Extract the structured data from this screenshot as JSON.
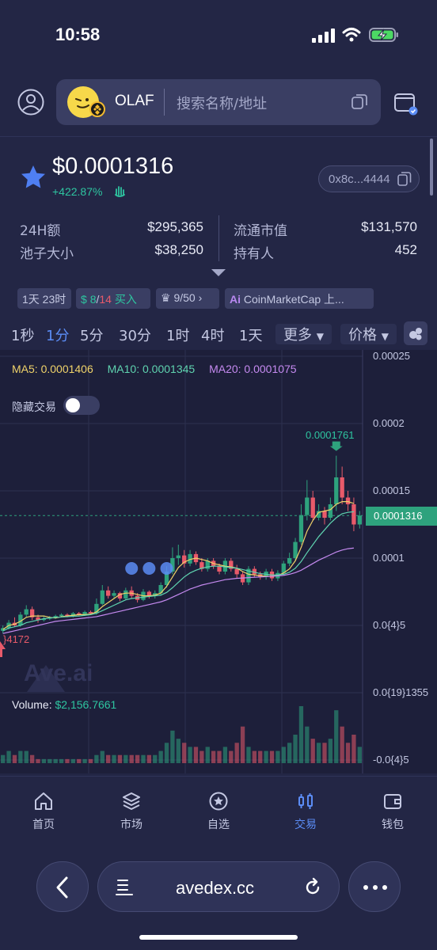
{
  "status_bar": {
    "time": "10:58"
  },
  "search": {
    "token_name": "OLAF",
    "placeholder": "搜索名称/地址"
  },
  "token": {
    "price": "$0.0001316",
    "change": "+422.87%",
    "address": "0x8c...4444"
  },
  "stats": {
    "volume_24h_label": "24H额",
    "volume_24h": "$295,365",
    "pool_label": "池子大小",
    "pool": "$38,250",
    "mcap_label": "流通市值",
    "mcap": "$131,570",
    "holders_label": "持有人",
    "holders": "452"
  },
  "pills": {
    "age": "1天 23时",
    "buy_a": "8",
    "buy_sep": "/",
    "buy_b": "14",
    "buy_label": " 买入",
    "rank": "9/50",
    "listing": "CoinMarketCap 上..."
  },
  "timeframes": [
    "1秒",
    "1分",
    "5分",
    "30分",
    "1时",
    "4时",
    "1天"
  ],
  "active_timeframe": "1分",
  "tf_more": "更多",
  "tf_price": "价格",
  "chart": {
    "ma5": "MA5: 0.0001406",
    "ma10": "MA10: 0.0001345",
    "ma20": "MA20: 0.0001075",
    "hide_trades": "隐藏交易",
    "y_labels": [
      "0.00025",
      "0.0002",
      "0.00015",
      "0.0001",
      "0.0{4}5",
      "0.0{19}1355",
      "-0.0{4}5"
    ],
    "current_price_tag": "0.0001316",
    "high_label": "0.0001761",
    "low_label": "}4172",
    "watermark": "Ave.ai",
    "volume_label": "Volume: ",
    "volume_value": "$2,156.7661",
    "colors": {
      "up": "#2ea27d",
      "down": "#e85a6a",
      "ma5": "#f0d36a",
      "ma10": "#5fd4b0",
      "ma20": "#c58af0"
    }
  },
  "chart_data": {
    "type": "candlestick",
    "title": "",
    "ylim": [
      -5e-05,
      0.00025
    ],
    "candles": [
      [
        4.6e-05,
        4.8e-05,
        4.4e-05,
        5e-05
      ],
      [
        4.8e-05,
        5.2e-05,
        4.7e-05,
        5.4e-05
      ],
      [
        5.2e-05,
        5e-05,
        4.9e-05,
        5.6e-05
      ],
      [
        5e-05,
        5.8e-05,
        4.9e-05,
        6e-05
      ],
      [
        5.8e-05,
        6.2e-05,
        5.6e-05,
        6.5e-05
      ],
      [
        6.2e-05,
        5.6e-05,
        5.4e-05,
        6.4e-05
      ],
      [
        5.6e-05,
        5.4e-05,
        5.2e-05,
        5.8e-05
      ],
      [
        5.4e-05,
        5.5e-05,
        5.3e-05,
        5.7e-05
      ],
      [
        5.5e-05,
        5.6e-05,
        5.4e-05,
        5.7e-05
      ],
      [
        5.6e-05,
        5.7e-05,
        5.5e-05,
        5.8e-05
      ],
      [
        5.7e-05,
        5.8e-05,
        5.6e-05,
        5.9e-05
      ],
      [
        5.8e-05,
        5.7e-05,
        5.6e-05,
        5.9e-05
      ],
      [
        5.7e-05,
        5.9e-05,
        5.6e-05,
        6e-05
      ],
      [
        5.9e-05,
        5.8e-05,
        5.7e-05,
        6e-05
      ],
      [
        5.8e-05,
        6e-05,
        5.7e-05,
        6.1e-05
      ],
      [
        6e-05,
        5.9e-05,
        5.8e-05,
        6.1e-05
      ],
      [
        5.9e-05,
        6.6e-05,
        5.8e-05,
        7e-05
      ],
      [
        6.6e-05,
        7.6e-05,
        6.5e-05,
        8e-05
      ],
      [
        7.6e-05,
        7.2e-05,
        7e-05,
        7.9e-05
      ],
      [
        7.2e-05,
        7.4e-05,
        7e-05,
        7.6e-05
      ],
      [
        7.4e-05,
        7e-05,
        6.8e-05,
        7.5e-05
      ],
      [
        7e-05,
        7.6e-05,
        6.9e-05,
        7.8e-05
      ],
      [
        7.6e-05,
        7.2e-05,
        7e-05,
        7.9e-05
      ],
      [
        7.2e-05,
        6.9e-05,
        6.7e-05,
        7.4e-05
      ],
      [
        6.9e-05,
        7.5e-05,
        6.8e-05,
        7.7e-05
      ],
      [
        7.5e-05,
        7.2e-05,
        7e-05,
        7.6e-05
      ],
      [
        7.2e-05,
        7.4e-05,
        7e-05,
        7.6e-05
      ],
      [
        7.4e-05,
        8e-05,
        7.2e-05,
        8.2e-05
      ],
      [
        8e-05,
        9e-05,
        7.8e-05,
        9.4e-05
      ],
      [
        9e-05,
        0.0001,
        8.8e-05,
        0.000108
      ],
      [
        0.0001,
        0.000102,
        9.5e-05,
        0.00011
      ],
      [
        0.000102,
        9.6e-05,
        9.3e-05,
        0.000106
      ],
      [
        9.6e-05,
        0.000103,
        9.4e-05,
        0.000106
      ],
      [
        0.000103,
        9.7e-05,
        9.5e-05,
        0.000105
      ],
      [
        9.7e-05,
        9.2e-05,
        9e-05,
        0.0001
      ],
      [
        9.2e-05,
        9.8e-05,
        9e-05,
        0.0001
      ],
      [
        9.8e-05,
        9.4e-05,
        9.2e-05,
        0.0001
      ],
      [
        9.4e-05,
        9e-05,
        8.8e-05,
        9.6e-05
      ],
      [
        9e-05,
        9.8e-05,
        8.8e-05,
        0.0001
      ],
      [
        9.8e-05,
        9.2e-05,
        9e-05,
        0.0001
      ],
      [
        9.2e-05,
        8.8e-05,
        8.5e-05,
        9.5e-05
      ],
      [
        8.8e-05,
        8.2e-05,
        8e-05,
        9e-05
      ],
      [
        8.2e-05,
        9.2e-05,
        8e-05,
        9.4e-05
      ],
      [
        9.2e-05,
        8.8e-05,
        8.6e-05,
        9.4e-05
      ],
      [
        8.8e-05,
        8.6e-05,
        8.4e-05,
        9e-05
      ],
      [
        8.6e-05,
        9e-05,
        8.4e-05,
        9.2e-05
      ],
      [
        9e-05,
        8.5e-05,
        8.3e-05,
        9.2e-05
      ],
      [
        8.5e-05,
        8.9e-05,
        8.3e-05,
        9.1e-05
      ],
      [
        8.9e-05,
        9.6e-05,
        8.8e-05,
        9.8e-05
      ],
      [
        9.6e-05,
        0.0001,
        9.4e-05,
        0.000104
      ],
      [
        0.0001,
        0.000112,
        9.8e-05,
        0.000115
      ],
      [
        0.000112,
        0.000132,
        0.00011,
        0.00014
      ],
      [
        0.000132,
        0.000145,
        0.000128,
        0.000158
      ],
      [
        0.000145,
        0.00013,
        0.000128,
        0.00015
      ],
      [
        0.00013,
        0.000135,
        0.000128,
        0.00014
      ],
      [
        0.000135,
        0.00013,
        0.000125,
        0.000138
      ],
      [
        0.00013,
        0.00014,
        0.000128,
        0.000145
      ],
      [
        0.00014,
        0.00016,
        0.000135,
        0.0001761
      ],
      [
        0.00016,
        0.000145,
        0.00014,
        0.000168
      ],
      [
        0.000145,
        0.00014,
        0.000135,
        0.00015
      ],
      [
        0.00014,
        0.000125,
        0.00012,
        0.000145
      ],
      [
        0.000125,
        0.0001316,
        0.000122,
        0.000135
      ]
    ],
    "volumes": [
      2,
      3,
      2,
      3,
      3,
      2,
      1,
      1,
      1,
      1,
      1,
      1,
      1,
      1,
      1,
      1,
      2,
      3,
      2,
      2,
      2,
      2,
      2,
      2,
      2,
      2,
      2,
      3,
      5,
      8,
      6,
      5,
      4,
      4,
      3,
      4,
      3,
      3,
      4,
      3,
      5,
      9,
      4,
      3,
      3,
      3,
      3,
      3,
      4,
      5,
      7,
      14,
      9,
      6,
      5,
      5,
      6,
      13,
      9,
      5,
      7,
      4
    ],
    "series": [
      {
        "name": "MA5",
        "values": [
          4.7e-05,
          5e-05,
          5.1e-05,
          5.3e-05,
          5.6e-05,
          5.7e-05,
          5.7e-05,
          5.7e-05,
          5.6e-05,
          5.55e-05,
          5.65e-05,
          5.7e-05,
          5.75e-05,
          5.8e-05,
          5.8e-05,
          5.85e-05,
          6e-05,
          6.4e-05,
          6.7e-05,
          7e-05,
          7.3e-05,
          7.4e-05,
          7.4e-05,
          7.3e-05,
          7.2e-05,
          7.2e-05,
          7.25e-05,
          7.4e-05,
          7.9e-05,
          8.6e-05,
          9.3e-05,
          9.7e-05,
          9.9e-05,
          0.0001,
          9.9e-05,
          9.8e-05,
          9.6e-05,
          9.5e-05,
          9.4e-05,
          9.35e-05,
          9.25e-05,
          9e-05,
          8.8e-05,
          8.75e-05,
          8.7e-05,
          8.65e-05,
          8.65e-05,
          8.7e-05,
          8.9e-05,
          9.2e-05,
          9.8e-05,
          0.000108,
          0.00012,
          0.000128,
          0.000134,
          0.000135,
          0.000136,
          0.00014,
          0.000142,
          0.000142,
          0.0001406
        ]
      },
      {
        "name": "MA10",
        "values": [
          4.6e-05,
          4.8e-05,
          4.9e-05,
          5e-05,
          5.2e-05,
          5.3e-05,
          5.4e-05,
          5.5e-05,
          5.55e-05,
          5.6e-05,
          5.62e-05,
          5.65e-05,
          5.68e-05,
          5.7e-05,
          5.75e-05,
          5.8e-05,
          5.9e-05,
          6.1e-05,
          6.3e-05,
          6.5e-05,
          6.7e-05,
          6.9e-05,
          7e-05,
          7.05e-05,
          7.1e-05,
          7.15e-05,
          7.2e-05,
          7.25e-05,
          7.45e-05,
          7.8e-05,
          8.2e-05,
          8.6e-05,
          8.9e-05,
          9.1e-05,
          9.25e-05,
          9.35e-05,
          9.4e-05,
          9.4e-05,
          9.35e-05,
          9.3e-05,
          9.25e-05,
          9.15e-05,
          9.05e-05,
          8.95e-05,
          8.85e-05,
          8.8e-05,
          8.75e-05,
          8.75e-05,
          8.8e-05,
          8.95e-05,
          9.25e-05,
          9.75e-05,
          0.000104,
          0.00011,
          0.000116,
          0.000121,
          0.000126,
          0.00013,
          0.000133,
          0.000134,
          0.0001345
        ]
      },
      {
        "name": "MA20",
        "values": [
          4.4e-05,
          4.5e-05,
          4.6e-05,
          4.7e-05,
          4.8e-05,
          4.9e-05,
          5e-05,
          5.1e-05,
          5.2e-05,
          5.3e-05,
          5.35e-05,
          5.4e-05,
          5.45e-05,
          5.5e-05,
          5.55e-05,
          5.6e-05,
          5.65e-05,
          5.75e-05,
          5.85e-05,
          5.95e-05,
          6.05e-05,
          6.15e-05,
          6.25e-05,
          6.35e-05,
          6.45e-05,
          6.55e-05,
          6.65e-05,
          6.75e-05,
          6.9e-05,
          7.1e-05,
          7.3e-05,
          7.5e-05,
          7.7e-05,
          7.85e-05,
          8e-05,
          8.1e-05,
          8.2e-05,
          8.3e-05,
          8.4e-05,
          8.45e-05,
          8.5e-05,
          8.52e-05,
          8.55e-05,
          8.58e-05,
          8.6e-05,
          8.62e-05,
          8.65e-05,
          8.68e-05,
          8.72e-05,
          8.8e-05,
          8.92e-05,
          9.1e-05,
          9.35e-05,
          9.6e-05,
          9.85e-05,
          0.0001005,
          0.0001025,
          0.0001045,
          0.000106,
          0.000107,
          0.0001075
        ]
      }
    ]
  },
  "bottom_nav": [
    {
      "label": "首页",
      "icon": "home-icon"
    },
    {
      "label": "市场",
      "icon": "layers-icon"
    },
    {
      "label": "自选",
      "icon": "star-circle-icon"
    },
    {
      "label": "交易",
      "icon": "candlestick-icon"
    },
    {
      "label": "钱包",
      "icon": "wallet-icon"
    }
  ],
  "active_nav": "交易",
  "browser": {
    "url": "avedex.cc"
  }
}
